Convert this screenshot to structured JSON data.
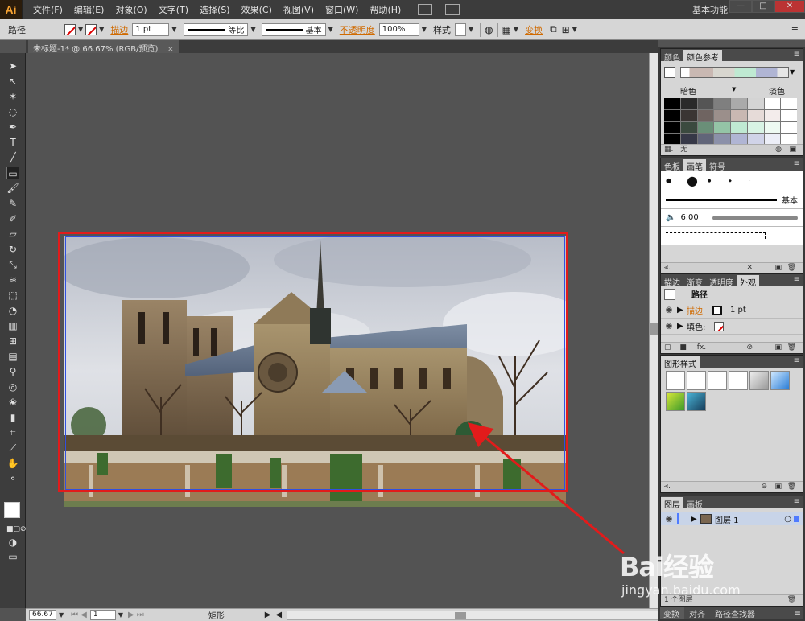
{
  "app": {
    "logo": "Ai",
    "workspace": "基本功能"
  },
  "menu": [
    "文件(F)",
    "编辑(E)",
    "对象(O)",
    "文字(T)",
    "选择(S)",
    "效果(C)",
    "视图(V)",
    "窗口(W)",
    "帮助(H)"
  ],
  "window_buttons": {
    "minimize": "—",
    "restore": "□",
    "close": "✕"
  },
  "controlbar": {
    "object_type": "路径",
    "stroke_label": "描边",
    "stroke_weight": "1 pt",
    "profile_label": "等比",
    "brush_label": "基本",
    "opacity_label": "不透明度",
    "opacity_value": "100%",
    "style_label": "样式",
    "transform_label": "变换"
  },
  "document": {
    "tab_title": "未标题-1* @ 66.67% (RGB/预览)",
    "close": "×"
  },
  "statusbar": {
    "zoom": "66.67",
    "artboard": "1",
    "tool_name": "矩形"
  },
  "panels": {
    "color": {
      "tabs": [
        "颜色",
        "颜色参考"
      ],
      "shade_label": "暗色",
      "tint_label": "淡色",
      "none_label": "无"
    },
    "brushes": {
      "tabs": [
        "色板",
        "画笔",
        "符号"
      ],
      "basic_label": "基本",
      "size_label": "6.00"
    },
    "appearance": {
      "tabs": [
        "描边",
        "渐变",
        "透明度",
        "外观"
      ],
      "title": "路径",
      "stroke_label": "描边",
      "stroke_value": "1 pt",
      "fill_label": "填色:",
      "fx_label": "fx."
    },
    "graphic_styles": {
      "tabs": [
        "图形样式"
      ]
    },
    "layers": {
      "tabs": [
        "图层",
        "画板"
      ],
      "layer_name": "图层 1",
      "footer": "1 个图层"
    },
    "bottom": {
      "tabs": [
        "变换",
        "对齐",
        "路径查找器"
      ]
    }
  },
  "watermark": {
    "main": "Bai经验",
    "sub": "jingyan.baidu.com"
  },
  "colors": {
    "selection_red": "#e21b1b",
    "path_blue": "#3050e0",
    "ui_dark": "#3c3c3c",
    "accent_orange": "#d06a00"
  }
}
